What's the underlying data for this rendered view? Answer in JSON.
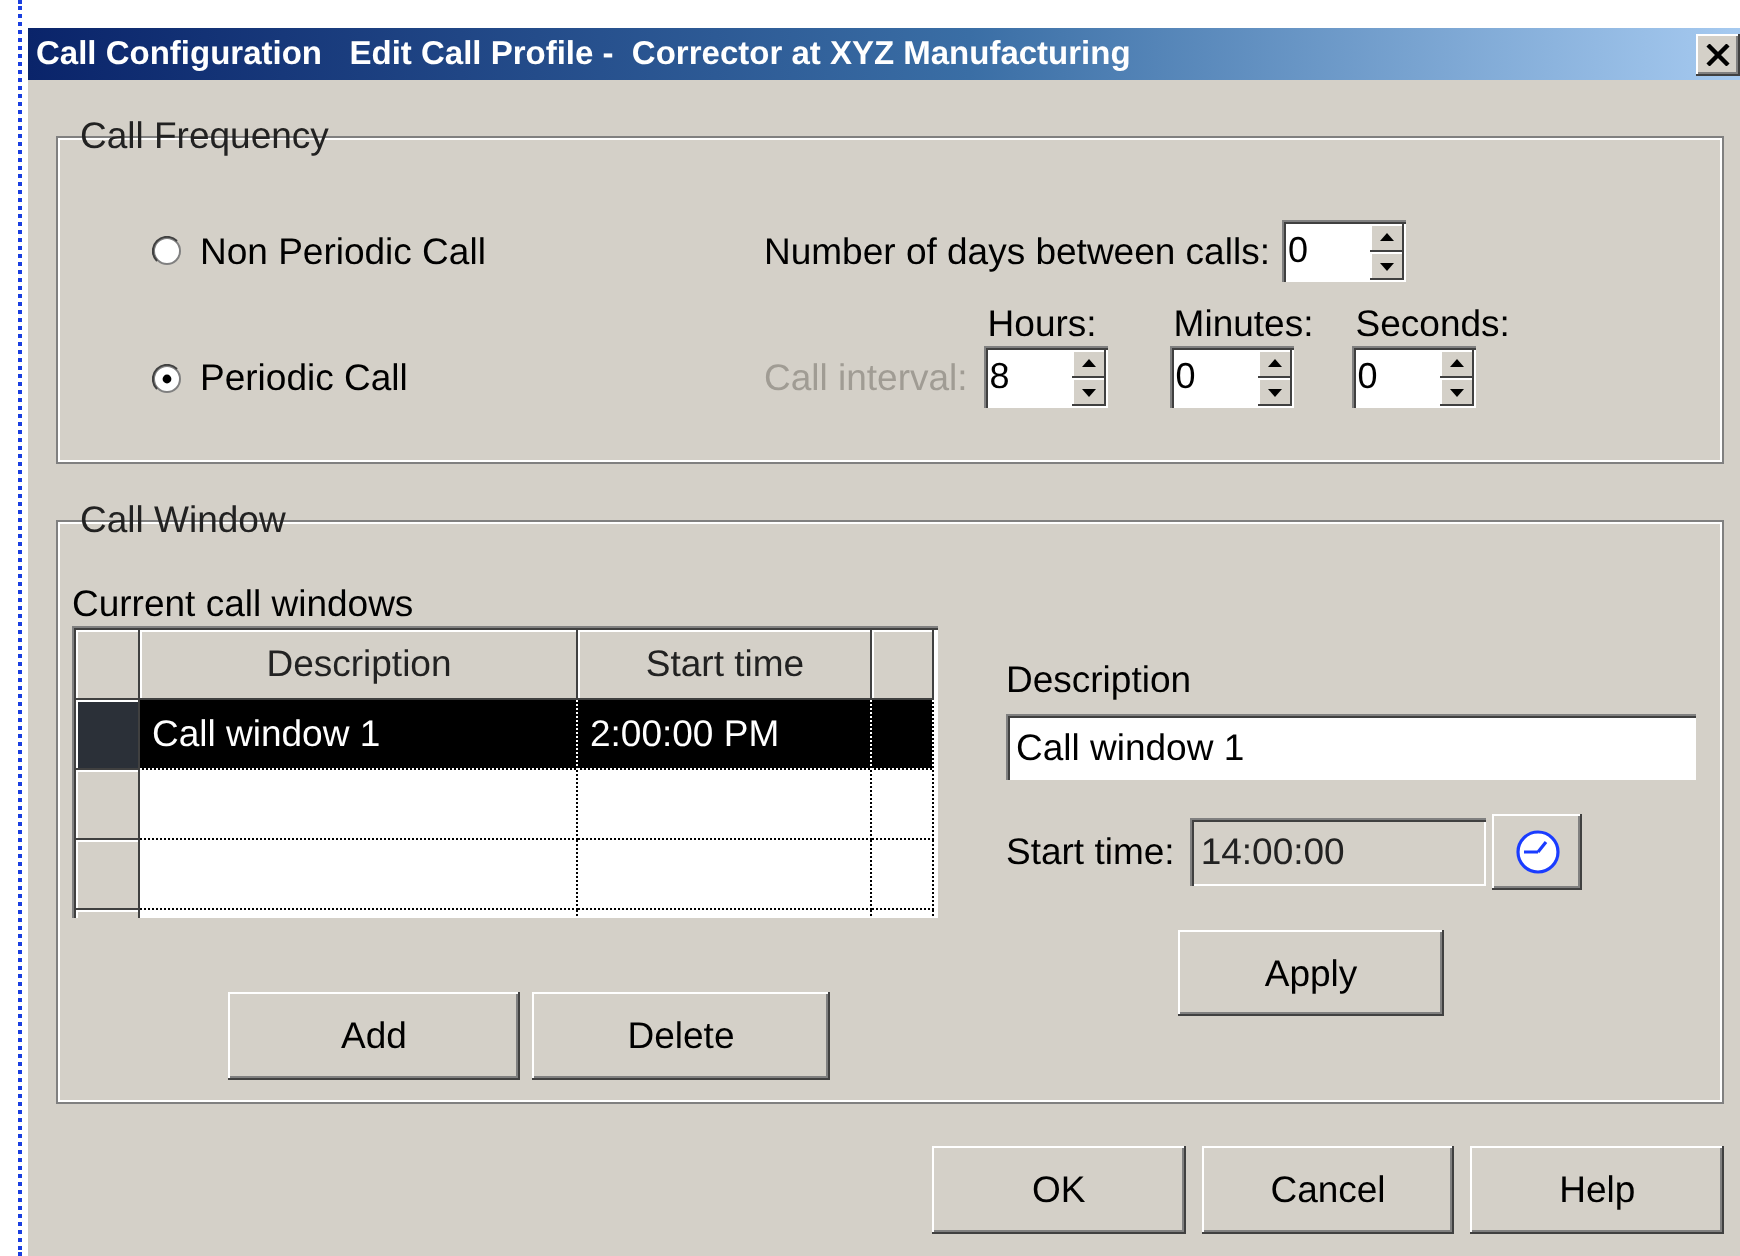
{
  "window": {
    "title": "Call Configuration   Edit Call Profile -  Corrector at XYZ Manufacturing"
  },
  "call_frequency": {
    "title": "Call Frequency",
    "modes": [
      {
        "label": "Non Periodic Call",
        "selected": false
      },
      {
        "label": "Periodic Call",
        "selected": true
      }
    ],
    "days_label": "Number of days between calls:",
    "days_value": "0",
    "interval_label": {
      "text": "Call interval:",
      "disabled": true
    },
    "interval_fields": [
      {
        "label": "Hours:",
        "value": "8"
      },
      {
        "label": "Minutes:",
        "value": "0"
      },
      {
        "label": "Seconds:",
        "value": "0"
      }
    ]
  },
  "call_window": {
    "title": "Call Window",
    "list_label": "Current call windows",
    "table": {
      "columns": [
        "Description",
        "Start time"
      ],
      "rows": [
        {
          "cells": [
            "Call window 1",
            "2:00:00 PM"
          ],
          "selected": true
        }
      ]
    },
    "list_buttons": [
      "Add",
      "Delete"
    ],
    "description_label": "Description",
    "description_value": "Call window 1",
    "start_time_label": "Start time:",
    "start_time_value": "14:00:00",
    "apply_button": "Apply"
  },
  "buttons": [
    "OK",
    "Cancel",
    "Help"
  ]
}
